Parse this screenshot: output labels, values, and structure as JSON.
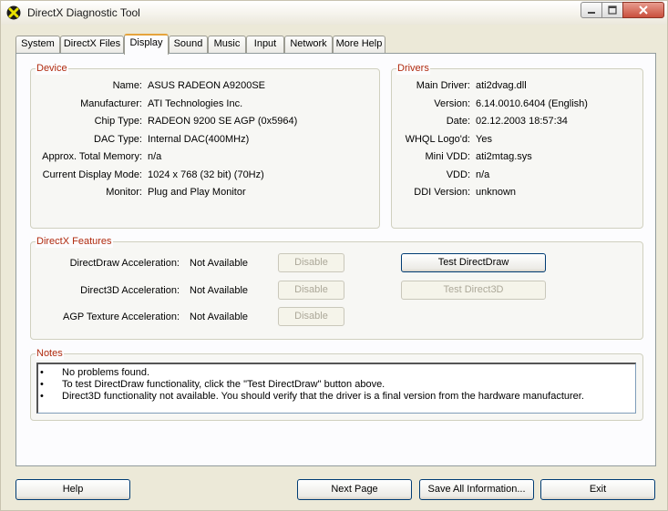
{
  "window": {
    "title": "DirectX Diagnostic Tool"
  },
  "tabs": [
    "System",
    "DirectX Files",
    "Display",
    "Sound",
    "Music",
    "Input",
    "Network",
    "More Help"
  ],
  "active_tab": "Display",
  "device": {
    "label": "Device",
    "rows": [
      {
        "label": "Name:",
        "value": "ASUS RADEON A9200SE"
      },
      {
        "label": "Manufacturer:",
        "value": "ATI Technologies Inc."
      },
      {
        "label": "Chip Type:",
        "value": "RADEON 9200 SE AGP (0x5964)"
      },
      {
        "label": "DAC Type:",
        "value": "Internal DAC(400MHz)"
      },
      {
        "label": "Approx. Total Memory:",
        "value": "n/a"
      },
      {
        "label": "Current Display Mode:",
        "value": "1024 x 768 (32 bit) (70Hz)"
      },
      {
        "label": "Monitor:",
        "value": "Plug and Play Monitor"
      }
    ]
  },
  "drivers": {
    "label": "Drivers",
    "rows": [
      {
        "label": "Main Driver:",
        "value": "ati2dvag.dll"
      },
      {
        "label": "Version:",
        "value": "6.14.0010.6404 (English)"
      },
      {
        "label": "Date:",
        "value": "02.12.2003 18:57:34"
      },
      {
        "label": "WHQL Logo'd:",
        "value": "Yes"
      },
      {
        "label": "Mini VDD:",
        "value": "ati2mtag.sys"
      },
      {
        "label": "VDD:",
        "value": "n/a"
      },
      {
        "label": "DDI Version:",
        "value": "unknown"
      }
    ]
  },
  "features": {
    "label": "DirectX Features",
    "rows": [
      {
        "label": "DirectDraw Acceleration:",
        "value": "Not Available",
        "button": "Disable"
      },
      {
        "label": "Direct3D Acceleration:",
        "value": "Not Available",
        "button": "Disable"
      },
      {
        "label": "AGP Texture Acceleration:",
        "value": "Not Available",
        "button": "Disable"
      }
    ],
    "test_directdraw": "Test DirectDraw",
    "test_direct3d": "Test Direct3D"
  },
  "notes": {
    "label": "Notes",
    "bullet": "•",
    "items": [
      "No problems found.",
      "To test DirectDraw functionality, click the \"Test DirectDraw\" button above.",
      "Direct3D functionality not available.  You should verify that the driver is a final version from the hardware manufacturer."
    ]
  },
  "footer": {
    "help": "Help",
    "next_page": "Next Page",
    "save_all": "Save All Information...",
    "exit": "Exit"
  },
  "icons": {
    "app": "directx-x-icon",
    "minimize": "minimize-icon",
    "maximize": "maximize-icon",
    "close": "close-icon"
  },
  "colors": {
    "group_label": "#b02a0e",
    "active_tab_accent": "#e6a43c",
    "window_bg": "#ece9d8"
  }
}
